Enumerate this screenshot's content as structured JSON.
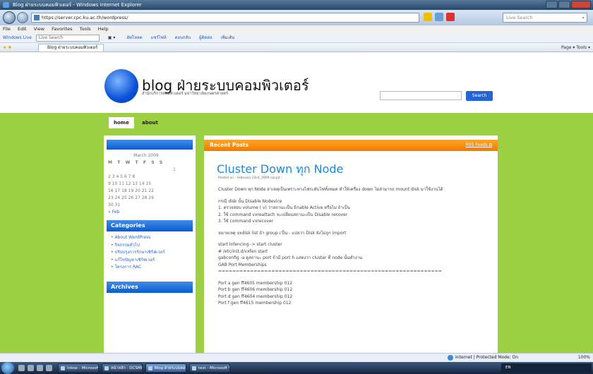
{
  "window": {
    "title": "Blog ฝ่ายระบบคอมพิวเตอร์ - Windows Internet Explorer"
  },
  "address": {
    "url": "https://server.cpc.ku.ac.th/wordpress/",
    "search_placeholder": "Live Search"
  },
  "menubar": [
    "File",
    "Edit",
    "View",
    "Favorites",
    "Tools",
    "Help"
  ],
  "linksbar": {
    "brand": "Windows Live",
    "search_placeholder": "Live Search",
    "links": [
      "อัพโหลด",
      "แชร์ไฟล์",
      "ตอบกลับ",
      "ผู้ติดต่อ",
      "เพิ่มเติม"
    ]
  },
  "tab": {
    "label": "Blog ฝ่ายระบบคอมพิวเตอร์",
    "commands": "Page ▾  Tools ▾"
  },
  "site": {
    "title": "blog ฝ่ายระบบคอมพิวเตอร์",
    "description": "สำนักบริการคอมพิวเตอร์ มหาวิทยาลัยเกษตรศาสตร์",
    "search_button": "Search"
  },
  "nav": [
    "home",
    "about"
  ],
  "calendar": {
    "month": "March 2009",
    "days_header": "M T W T F S S",
    "rows": [
      "1",
      "2 3 4 5 6 7 8",
      "9 10 11 12 13 14 15",
      "16 17 18 19 20 21 22",
      "23 24 25 26 27 28 29",
      "30 31"
    ],
    "prev": "« Feb"
  },
  "categories": {
    "heading": "Categories",
    "items": [
      "About WordPress",
      "กิจกรรมทั่วไป",
      "ปรับปรุงการรักษาเซิร์ฟเวอร์",
      "แก้ไขปัญหาเซิร์ฟเวอร์",
      "โครงการ RAC"
    ]
  },
  "archives": {
    "heading": "Archives"
  },
  "recent": {
    "heading": "Recent Posts",
    "rss": "RSS Feeds"
  },
  "post": {
    "title": "Cluster Down ทุก Node",
    "meta": "Posted on : February 23rd, 2009 cpcpjt :",
    "intro": "Cluster Down ทุก Node สาเหตุเป็นเพราะทางไฟระดับไฟทั้งหมด ทำให้เครื่อง down ไม่สามารถ mount disk มาใช้งานได้",
    "case_heading": "กรณี disk นั้น Disable Nodevice",
    "steps": [
      "1. ตรวจสอบ volume ( v) ว่าสถานะเป็น Enable Active หรือไม่ ถ้าเป็น",
      "2. ใช้ command vxreattach จะเปลี่ยนสถานะเป็น Disable recover",
      "3. ใช้ command vxrecover"
    ],
    "note": "หมายเหตุ vxdisk list ถ้า group เ'ป็น - แปลว่า Disk ยังไม่ถูก import",
    "commands": [
      "start lofencing -> start cluster",
      "# /etc/init.d/vxfen start",
      "gabconfig -a ดูสถานะ port ถ้ามี port h แสดงว่า cluster ที่ node นั้นทำงาน",
      "GAB Port Memberships",
      "==============================================================="
    ],
    "ports": [
      "Port a gen   ff4605 membership 012",
      "Port b gen   ff4606 membership 012",
      "Port d gen   ff4604 membership 012",
      "Port f gen   ff4615 membership 012"
    ]
  },
  "statusbar": {
    "zone": "Internet | Protected Mode: On",
    "zoom": "100%"
  },
  "taskbar": {
    "buttons": [
      "Inbox - Microsoft...",
      "หน้าหลัก - DCSMBX...",
      "Blog ฝ่ายระบบคอมพิ...",
      "test - Microsoft Wo..."
    ],
    "tray": "EN"
  }
}
